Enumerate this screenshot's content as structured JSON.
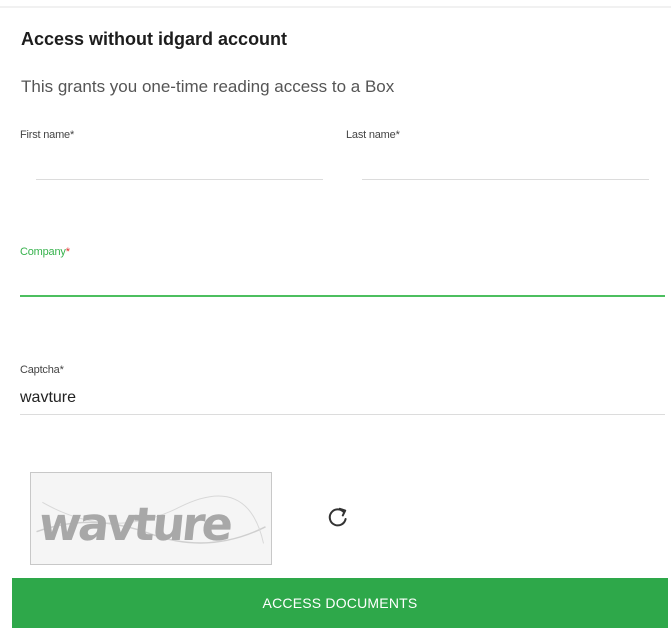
{
  "form": {
    "title": "Access without idgard account",
    "subtitle": "This grants you one-time reading access to a Box",
    "first_name": {
      "label": "First name",
      "required_mark": "*",
      "value": ""
    },
    "last_name": {
      "label": "Last name",
      "required_mark": "*",
      "value": ""
    },
    "company": {
      "label": "Company",
      "required_mark": "*",
      "value": ""
    },
    "captcha": {
      "label": "Captcha",
      "required_mark": "*",
      "value": "wavture",
      "image_text": "wavture"
    },
    "refresh_icon": "refresh-icon",
    "submit_label": "ACCESS DOCUMENTS"
  },
  "colors": {
    "accent_green": "#2ea84a",
    "focus_green": "#4cbf5f",
    "required_red": "#e03131"
  }
}
